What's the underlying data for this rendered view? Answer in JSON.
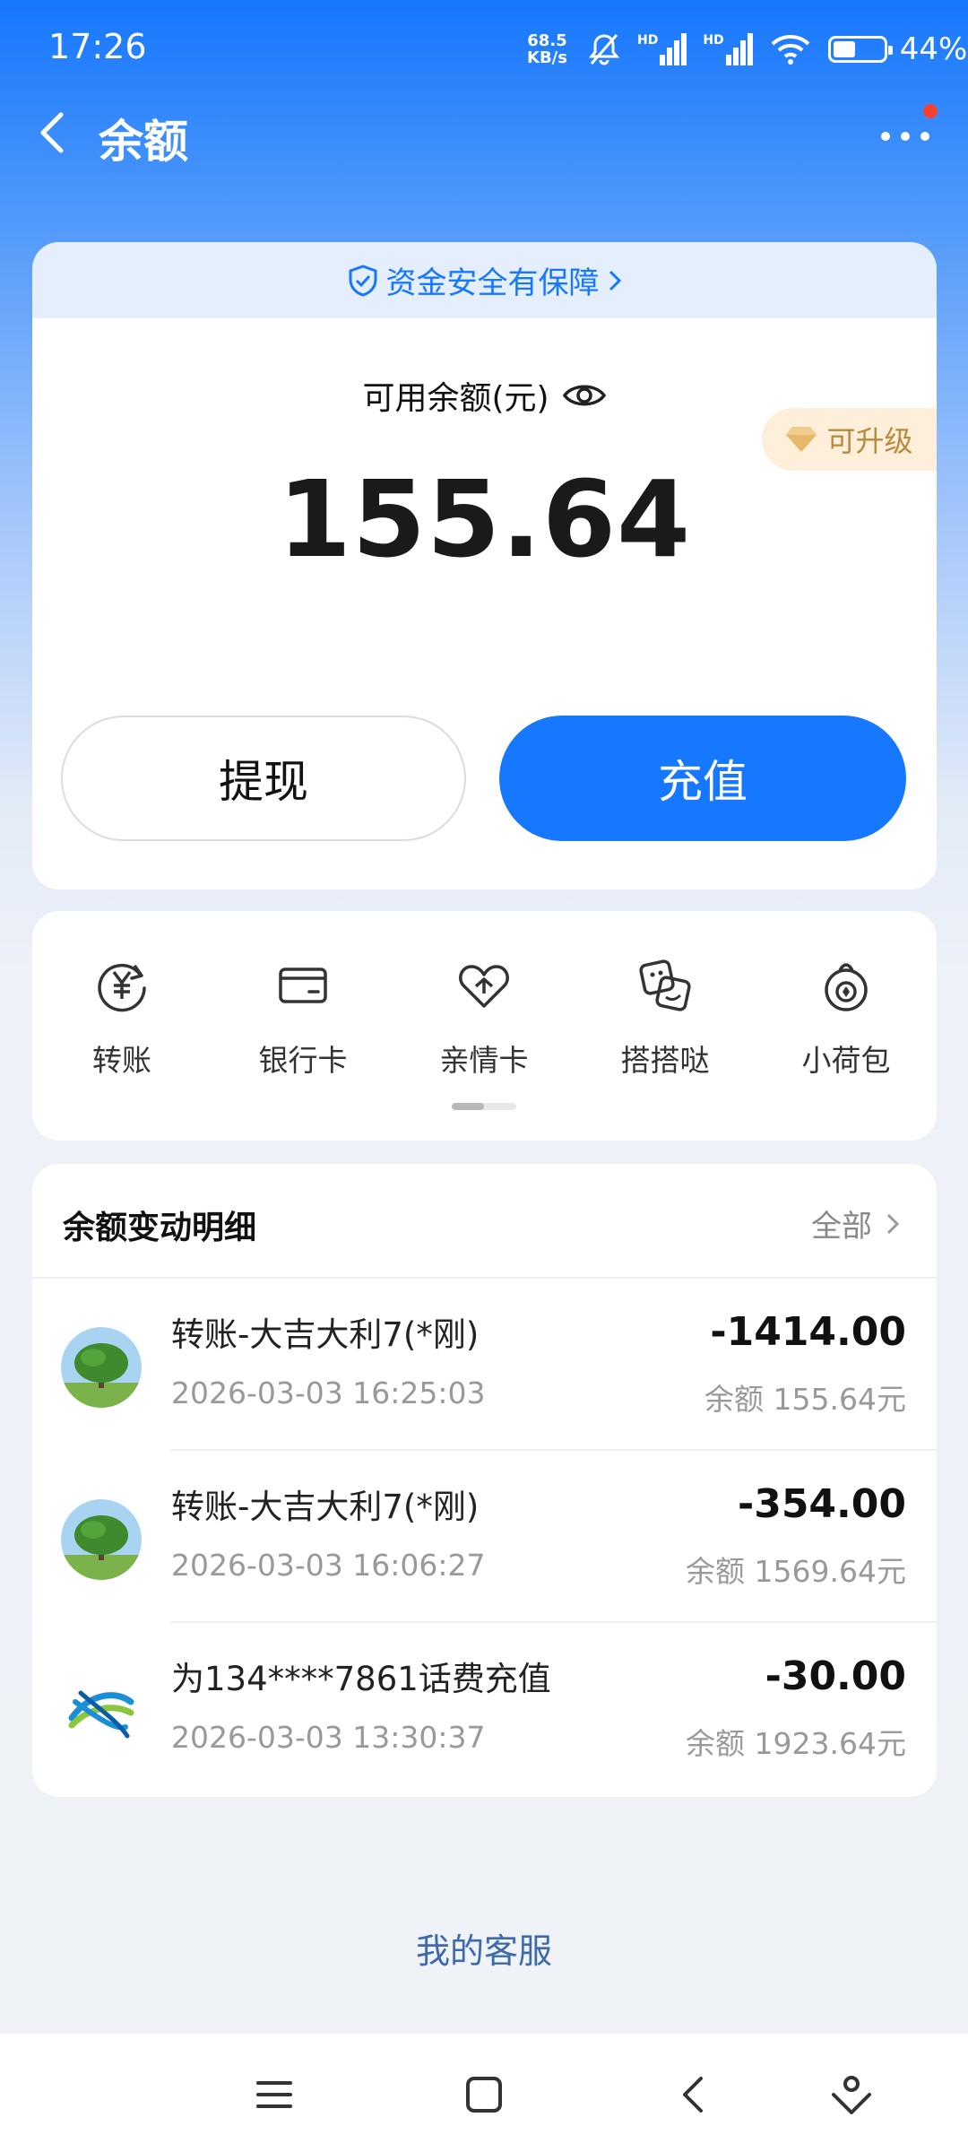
{
  "status_bar": {
    "time": "17:26",
    "net_speed_value": "68.5",
    "net_speed_unit": "KB/s",
    "battery": "44%",
    "battery_level": 0.44,
    "hd_label": "HD"
  },
  "header": {
    "title": "余额"
  },
  "balance_card": {
    "security_text": "资金安全有保障",
    "available_label": "可用余额(元)",
    "upgrade_label": "可升级",
    "amount": "155.64",
    "withdraw_label": "提现",
    "recharge_label": "充值"
  },
  "quick_actions": {
    "items": [
      {
        "label": "转账",
        "icon": "transfer-yuan-icon"
      },
      {
        "label": "银行卡",
        "icon": "bank-card-icon"
      },
      {
        "label": "亲情卡",
        "icon": "family-card-icon"
      },
      {
        "label": "搭搭哒",
        "icon": "dadada-icon"
      },
      {
        "label": "小荷包",
        "icon": "small-purse-icon"
      }
    ]
  },
  "transactions": {
    "title": "余额变动明细",
    "all_label": "全部",
    "items": [
      {
        "name": "转账-大吉大利7(*刚)",
        "time": "2026-03-03 16:25:03",
        "amount": "-1414.00",
        "balance": "余额 155.64元",
        "avatar": "tree-avatar"
      },
      {
        "name": "转账-大吉大利7(*刚)",
        "time": "2026-03-03 16:06:27",
        "amount": "-354.00",
        "balance": "余额 1569.64元",
        "avatar": "tree-avatar"
      },
      {
        "name": "为134****7861话费充值",
        "time": "2026-03-03 13:30:37",
        "amount": "-30.00",
        "balance": "余额 1923.64元",
        "avatar": "china-mobile-logo"
      }
    ]
  },
  "footer": {
    "customer_service": "我的客服"
  },
  "colors": {
    "accent": "#1677ff",
    "upgrade_text": "#b98a3e",
    "notification_dot": "#f5412f"
  }
}
